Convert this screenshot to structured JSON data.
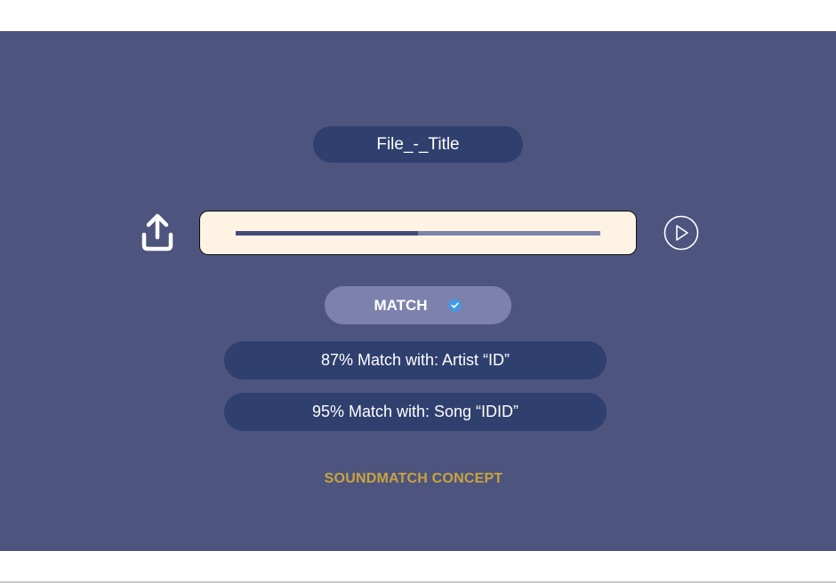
{
  "file": {
    "title": "File_-_Title"
  },
  "player": {
    "progress": 0.5,
    "icons": {
      "upload": "upload-icon",
      "play": "play-circle-icon"
    }
  },
  "match": {
    "label": "MATCH",
    "icon": "verified-check-icon"
  },
  "results": [
    {
      "text": "87% Match with: Artist “ID”"
    },
    {
      "text": "95% Match with: Song “IDID”"
    }
  ],
  "brand": {
    "label": "SOUNDMATCH CONCEPT"
  },
  "colors": {
    "panel": "#4d547e",
    "pill_dark": "#2f3f6e",
    "pill_light": "#7d82ad",
    "player_bg": "#fff4e3",
    "accent_gold": "#c9a43d",
    "check_blue": "#3d9be9"
  }
}
